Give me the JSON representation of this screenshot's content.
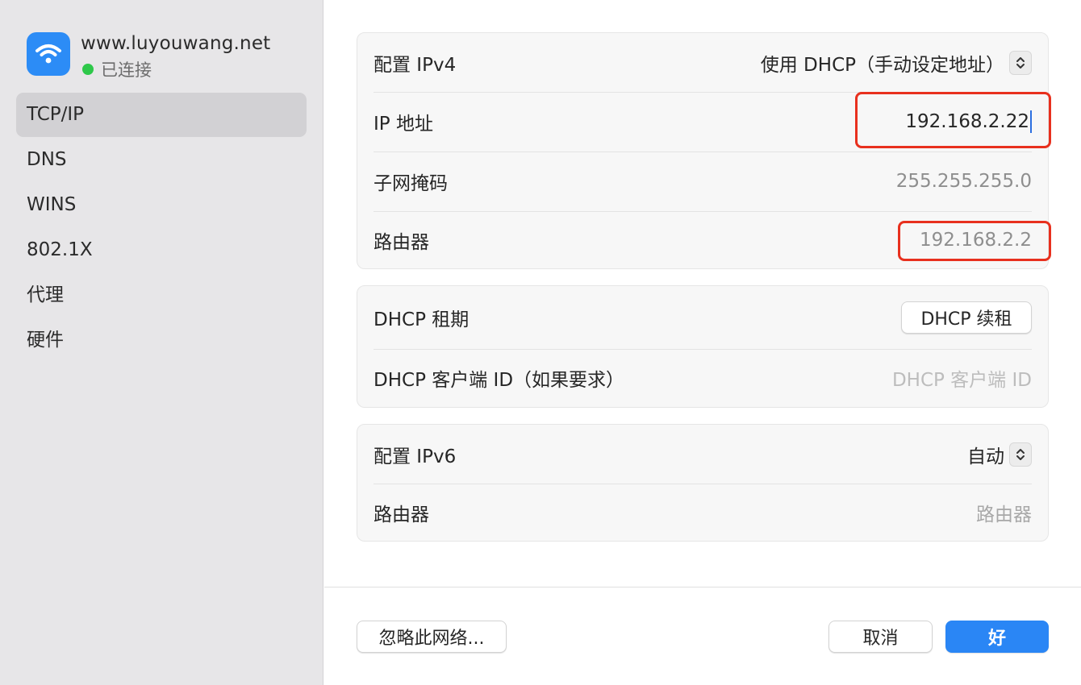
{
  "network": {
    "name": "www.luyouwang.net",
    "status": "已连接"
  },
  "sidebar": {
    "items": [
      {
        "label": "TCP/IP",
        "active": true
      },
      {
        "label": "DNS"
      },
      {
        "label": "WINS"
      },
      {
        "label": "802.1X"
      },
      {
        "label": "代理"
      },
      {
        "label": "硬件"
      }
    ]
  },
  "ipv4": {
    "configure_label": "配置 IPv4",
    "configure_value": "使用 DHCP（手动设定地址）",
    "ip_label": "IP 地址",
    "ip_value": "192.168.2.22",
    "subnet_label": "子网掩码",
    "subnet_value": "255.255.255.0",
    "router_label": "路由器",
    "router_value": "192.168.2.2"
  },
  "dhcp": {
    "lease_label": "DHCP 租期",
    "renew_button": "DHCP 续租",
    "client_id_label": "DHCP 客户端 ID（如果要求）",
    "client_id_placeholder": "DHCP 客户端 ID"
  },
  "ipv6": {
    "configure_label": "配置 IPv6",
    "configure_value": "自动",
    "router_label": "路由器",
    "router_placeholder": "路由器"
  },
  "footer": {
    "forget_button": "忽略此网络...",
    "cancel_button": "取消",
    "ok_button": "好"
  },
  "colors": {
    "accent": "#2a86f5",
    "highlight": "#e8301e",
    "connected": "#2ec84a",
    "sidebar_bg": "#e7e6e8"
  },
  "icons": {
    "network": "wifi-icon",
    "popup": "chevron-updown-icon"
  }
}
